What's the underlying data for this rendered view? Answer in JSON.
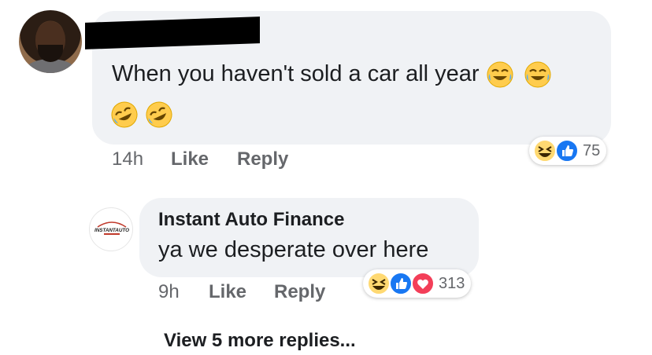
{
  "comment1": {
    "text": "When you haven't sold a car all year",
    "time": "14h",
    "like_label": "Like",
    "reply_label": "Reply",
    "reaction_count": "75",
    "reactions": [
      "haha-icon",
      "like-icon"
    ],
    "inline_emojis": [
      "joy-emoji",
      "joy-emoji",
      "rofl-emoji",
      "rofl-emoji"
    ]
  },
  "comment2": {
    "author": "Instant Auto Finance",
    "text": "ya we desperate over here",
    "time": "9h",
    "like_label": "Like",
    "reply_label": "Reply",
    "reaction_count": "313",
    "reactions": [
      "haha-icon",
      "like-icon",
      "love-icon"
    ],
    "avatar_logo_text": "INSTANTAUTO"
  },
  "view_more_label": "View 5 more replies..."
}
